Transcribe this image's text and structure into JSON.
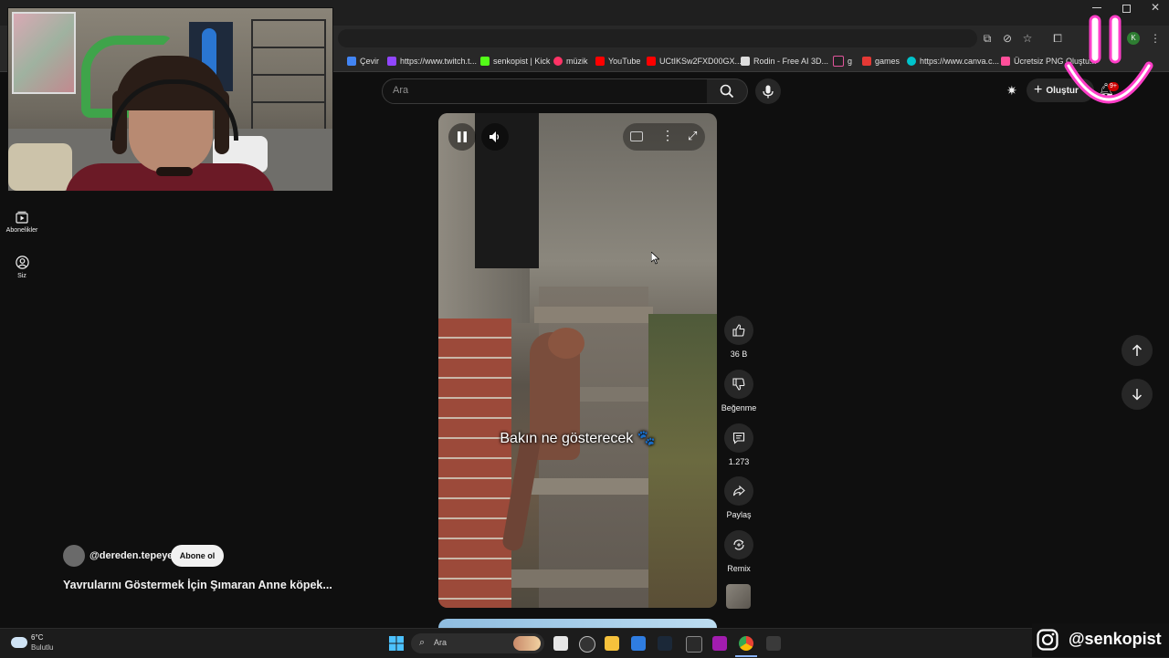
{
  "browser": {
    "bookmarks": [
      {
        "label": "Çevir",
        "color": "#4285f4"
      },
      {
        "label": "https://www.twitch.t...",
        "color": "#9146ff"
      },
      {
        "label": "senkopist | Kick",
        "color": "#53fc18"
      },
      {
        "label": "müzik",
        "color": "#ff3366"
      },
      {
        "label": "YouTube",
        "color": "#ff0000"
      },
      {
        "label": "UCtIKSw2FXD00GX...",
        "color": "#ff0000"
      },
      {
        "label": "Rodin - Free AI 3D...",
        "color": "#dddddd"
      },
      {
        "label": "g",
        "color": "#222222"
      },
      {
        "label": "games",
        "color": "#e53935"
      },
      {
        "label": "https://www.canva.c...",
        "color": "#00c4cc"
      },
      {
        "label": "Ücretsiz PNG Oluştu...",
        "color": "#ff4f9a"
      }
    ],
    "profile_initial": "K"
  },
  "youtube": {
    "search_placeholder": "Ara",
    "create_label": "Oluştur",
    "notifications_badge": "9+",
    "sidebar": [
      {
        "label": "Abonelikler",
        "icon": "subscriptions-icon"
      },
      {
        "label": "Siz",
        "icon": "you-icon"
      }
    ],
    "video": {
      "caption": "Bakın ne gösterecek 🐾",
      "channel": "@dereden.tepeye",
      "subscribe_label": "Abone ol",
      "title": "Yavrularını Göstermek İçin Şımaran Anne köpek..."
    },
    "actions": {
      "like_count": "36 B",
      "dislike_label": "Beğenme",
      "comment_count": "1.273",
      "share_label": "Paylaş",
      "remix_label": "Remix"
    }
  },
  "taskbar": {
    "weather_temp": "6°C",
    "weather_desc": "Bulutlu",
    "search_placeholder": "Ara"
  },
  "overlay": {
    "instagram_handle": "@senkopist",
    "accent_color": "#ff3ec8"
  }
}
